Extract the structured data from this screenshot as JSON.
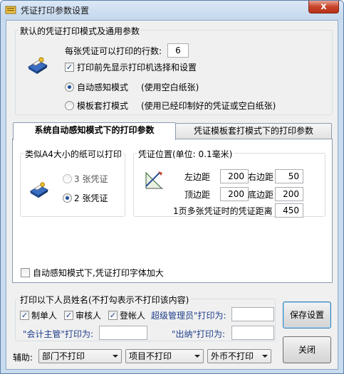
{
  "window": {
    "title": "凭证打印参数设置",
    "close_label": "x"
  },
  "general": {
    "legend": "默认的凭证打印模式及通用参数",
    "rows_label": "每张凭证可以打印的行数:",
    "rows_value": "6",
    "show_printer_label": "打印前先显示打印机选择和设置",
    "show_printer_checked": true,
    "mode_auto_label": "自动感知模式",
    "mode_auto_desc": "(使用空白纸张)",
    "mode_template_label": "模板套打模式",
    "mode_template_desc": "(使用已经印制好的凭证或空白纸张)",
    "selected_mode": "auto"
  },
  "tabs": [
    {
      "label": "系统自动感知模式下的打印参数",
      "active": true
    },
    {
      "label": "凭证模板套打模式下的打印参数",
      "active": false
    }
  ],
  "auto_panel": {
    "a4_legend": "类似A4大小的纸可以打印",
    "opt3": "3 张凭证",
    "opt2": "2 张凭证",
    "selected_count": 2,
    "pos_legend": "凭证位置(单位: 0.1毫米)",
    "left_label": "左边距",
    "left_value": "200",
    "right_label": "右边距",
    "right_value": "50",
    "top_label": "顶边距",
    "top_value": "200",
    "bottom_label": "底边距",
    "bottom_value": "200",
    "distance_label": "1页多张凭证时的凭证距离",
    "distance_value": "450",
    "font_enlarge_label": "自动感知模式下,凭证打印字体加大",
    "font_enlarge_checked": false
  },
  "names": {
    "legend": "打印以下人员姓名(不打勾表示不打印该内容)",
    "maker": "制单人",
    "maker_checked": true,
    "auditor": "审核人",
    "auditor_checked": true,
    "bookkeeper": "登帐人",
    "bookkeeper_checked": true,
    "super_admin_label": "超级管理员\"打印为:",
    "super_admin_value": "",
    "accountant_label": "\"会计主管\"打印为:",
    "accountant_value": "",
    "cashier_label": "\"出纳\"打印为:",
    "cashier_value": ""
  },
  "buttons": {
    "save": "保存设置",
    "close": "关闭"
  },
  "aux": {
    "label": "辅助:",
    "dept": "部门不打印",
    "project": "项目不打印",
    "currency": "外币不打印"
  }
}
